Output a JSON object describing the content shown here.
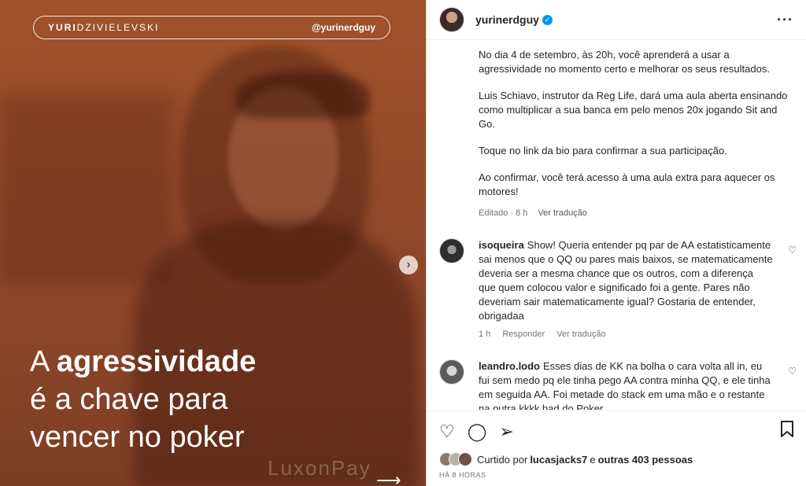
{
  "post_image": {
    "brand_first": "YURI",
    "brand_last": "DZIVIELEVSKI",
    "brand_handle": "@yurinerdguy",
    "headline_line1_prefix": "A ",
    "headline_line1_bold": "agressividade",
    "headline_line2": "é a chave para",
    "headline_line3": "vencer no poker",
    "watermark": "LuxonPay",
    "next_icon": "chevron-right-icon",
    "colors": {
      "overlay": "#9a4e2b",
      "text": "#ffffff"
    }
  },
  "header": {
    "username": "yurinerdguy",
    "verified_icon": "verified-badge-icon",
    "more_icon": "more-options-icon"
  },
  "caption": {
    "paragraphs": [
      "No dia 4 de setembro, às 20h, você aprenderá a usar a agressividade no momento certo e melhorar os seus resultados.",
      "Luis Schiavo, instrutor da Reg Life, dará uma aula aberta ensinando como multiplicar a sua banca em pelo menos 20x jogando Sit and Go.",
      "Toque no link da bio para confirmar a sua participação.",
      "Ao confirmar, você terá acesso à uma aula extra para aquecer os motores!"
    ],
    "edited": "Editado · 8 h",
    "see_translation": "Ver tradução"
  },
  "comments": [
    {
      "user": "isoqueira",
      "text": "Show! Queria entender pq par de AA estatisticamente sai menos que o QQ ou pares mais baixos, se matematicamente deveria ser a mesma chance que os outros, com a diferença que quem colocou valor e significado foi a gente. Pares não deveriam sair matematicamente igual? Gostaria de entender, obrigadaa",
      "time": "1 h",
      "reply": "Responder",
      "translate": "Ver tradução"
    },
    {
      "user": "leandro.lodo",
      "text": "Esses dias de KK na bolha o cara volta all in, eu fui sem medo pq ele tinha pego AA contra minha QQ, e ele tinha em seguida AA. Foi metade do stack em uma mão e o restante na outra kkkk bad do Poker"
    }
  ],
  "actions": {
    "like_icon": "heart-icon",
    "comment_icon": "comment-icon",
    "share_icon": "send-icon",
    "save_icon": "bookmark-icon"
  },
  "likes": {
    "prefix": "Curtido por",
    "user": "lucasjacks7",
    "middle": "e",
    "others": "outras 403 pessoas"
  },
  "timestamp": "HÁ 8 HORAS"
}
